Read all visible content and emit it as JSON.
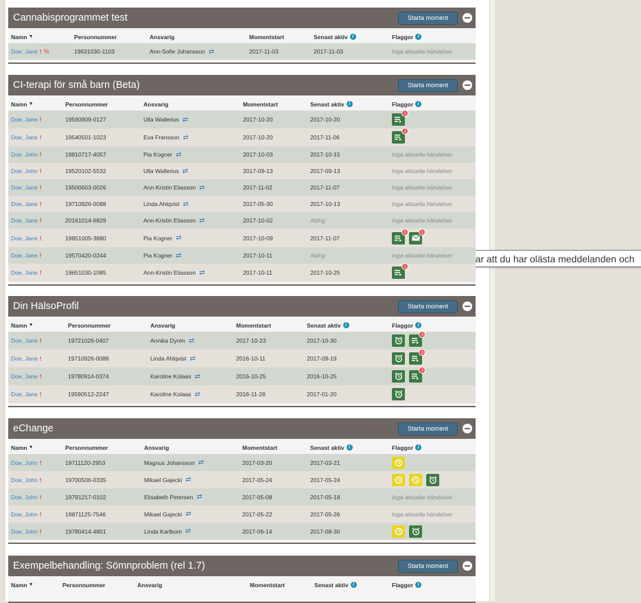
{
  "columns": {
    "name": "Namn",
    "personnummer": "Personnummer",
    "ansvarig": "Ansvarig",
    "momentstart": "Momentstart",
    "senast_aktiv": "Senast aktiv",
    "flaggor": "Flaggor"
  },
  "start_label": "Starta moment",
  "no_events": "Inga aktuella händelser",
  "tooltip": "Flaggan visar att du har olästa meddelanden och",
  "colors": {
    "panel_header": "#6e6663",
    "start_button": "#446c86",
    "row_odd": "#d2d8cf",
    "row_even": "#e6e0db",
    "link": "#3a7fc0",
    "flag_green": "#3d7a44",
    "flag_yellow": "#e8d42a",
    "badge_red": "#e05050"
  },
  "panels": [
    {
      "title": "Cannabisprogrammet test",
      "rows": [
        {
          "name": "Doe, Jane",
          "warn": "!",
          "link_icon": true,
          "pnr": "19631030-1103",
          "ansvarig": "Ann-Sofie Johansson",
          "start": "2017-11-03",
          "last": "2017-11-03",
          "last_muted": false,
          "flags_text": "Inga aktuella händelser",
          "flags": []
        }
      ]
    },
    {
      "title": "CI-terapi för små barn (Beta)",
      "rows": [
        {
          "name": "Doe, Jane",
          "warn": "!",
          "pnr": "19590909-0127",
          "ansvarig": "Ulla Wallerius",
          "start": "2017-10-20",
          "last": "2017-10-20",
          "last_muted": false,
          "flags": [
            {
              "type": "list",
              "color": "green",
              "badge": "1"
            }
          ]
        },
        {
          "name": "Doe, Jane",
          "warn": "!",
          "pnr": "19540501-1023",
          "ansvarig": "Eva Fransson",
          "start": "2017-10-20",
          "last": "2017-11-06",
          "last_muted": false,
          "flags": [
            {
              "type": "list",
              "color": "green",
              "badge": "2"
            }
          ]
        },
        {
          "name": "Doe, John",
          "warn": "!",
          "pnr": "19810717-4057",
          "ansvarig": "Pia Kogner",
          "start": "2017-10-03",
          "last": "2017-10-15",
          "last_muted": false,
          "flags_text": "Inga aktuella händelser",
          "flags": []
        },
        {
          "name": "Doe, John",
          "warn": "!",
          "pnr": "19520102-5532",
          "ansvarig": "Ulla Wallerius",
          "start": "2017-09-13",
          "last": "2017-09-13",
          "last_muted": false,
          "flags_text": "Inga aktuella händelser",
          "flags": []
        },
        {
          "name": "Doe, Jane",
          "warn": "!",
          "pnr": "19500603-0026",
          "ansvarig": "Ann-Kristin Eliasson",
          "start": "2017-11-02",
          "last": "2017-11-07",
          "last_muted": false,
          "flags_text": "Inga aktuella händelser",
          "flags": []
        },
        {
          "name": "Doe, Jane",
          "warn": "!",
          "pnr": "19710926-0088",
          "ansvarig": "Linda Ahlqvist",
          "start": "2017-05-30",
          "last": "2017-10-13",
          "last_muted": false,
          "flags_text": "Inga aktuella händelser",
          "flags": []
        },
        {
          "name": "Doe, Jane",
          "warn": "!",
          "pnr": "20161014-6829",
          "ansvarig": "Ann-Kristin Eliasson",
          "start": "2017-10-02",
          "last": "Aldrig",
          "last_muted": true,
          "flags_text": "Inga aktuella händelser",
          "flags": []
        },
        {
          "name": "Doe, Jane",
          "warn": "!",
          "pnr": "19851005-3880",
          "ansvarig": "Pia Kogner",
          "start": "2017-10-09",
          "last": "2017-11-07",
          "last_muted": false,
          "flags": [
            {
              "type": "list",
              "color": "green",
              "badge": "3"
            },
            {
              "type": "mail",
              "color": "green",
              "badge": "1"
            }
          ]
        },
        {
          "name": "Doe, Jane",
          "warn": "!",
          "pnr": "19570420-0244",
          "ansvarig": "Pia Kogner",
          "start": "2017-10-11",
          "last": "Aldrig",
          "last_muted": true,
          "flags_text": "Inga aktuella händelser",
          "flags": []
        },
        {
          "name": "Doe, Jane",
          "warn": "!",
          "pnr": "19651030-1085",
          "ansvarig": "Ann-Kristin Eliasson",
          "start": "2017-10-11",
          "last": "2017-10-25",
          "last_muted": false,
          "flags": [
            {
              "type": "list",
              "color": "green",
              "badge": "1"
            }
          ]
        }
      ]
    },
    {
      "title": "Din HälsoProfil",
      "rows": [
        {
          "name": "Doe, Jane",
          "warn": "!",
          "pnr": "19721026-0407",
          "ansvarig": "Annika Dyrén",
          "start": "2017-10-23",
          "last": "2017-10-30",
          "last_muted": false,
          "flags": [
            {
              "type": "alarm",
              "color": "green"
            },
            {
              "type": "list",
              "color": "green",
              "badge": "3"
            }
          ]
        },
        {
          "name": "Doe, Jane",
          "warn": "!",
          "pnr": "19710926-0088",
          "ansvarig": "Linda Ahlqvist",
          "start": "2016-10-11",
          "last": "2017-09-19",
          "last_muted": false,
          "flags": [
            {
              "type": "alarm",
              "color": "green"
            },
            {
              "type": "list",
              "color": "green",
              "badge": "3"
            }
          ]
        },
        {
          "name": "Doe, Jane",
          "warn": "!",
          "pnr": "19780914-0374",
          "ansvarig": "Karoline Kolaas",
          "start": "2016-10-25",
          "last": "2016-10-25",
          "last_muted": false,
          "flags": [
            {
              "type": "alarm",
              "color": "green"
            },
            {
              "type": "list",
              "color": "green",
              "badge": "3"
            }
          ]
        },
        {
          "name": "Doe, Jane",
          "warn": "!",
          "pnr": "19590512-2247",
          "ansvarig": "Karoline Kolaas",
          "start": "2016-11-26",
          "last": "2017-01-20",
          "last_muted": false,
          "flags": [
            {
              "type": "alarm",
              "color": "green"
            }
          ]
        }
      ]
    },
    {
      "title": "eChange",
      "rows": [
        {
          "name": "Doe, John",
          "warn": "!",
          "pnr": "19711120-2953",
          "ansvarig": "Magnus Johansson",
          "start": "2017-03-20",
          "last": "2017-03-21",
          "last_muted": false,
          "flags": [
            {
              "type": "clock",
              "color": "yellow"
            }
          ]
        },
        {
          "name": "Doe, John",
          "warn": "!",
          "pnr": "19700506-0335",
          "ansvarig": "Mikael Gajecki",
          "start": "2017-05-24",
          "last": "2017-05-24",
          "last_muted": false,
          "flags": [
            {
              "type": "clock",
              "color": "yellow"
            },
            {
              "type": "clock",
              "color": "yellow"
            },
            {
              "type": "alarm",
              "color": "green"
            }
          ]
        },
        {
          "name": "Doe, John",
          "warn": "!",
          "pnr": "19791217-0102",
          "ansvarig": "Elisabeth Petersen",
          "start": "2017-05-08",
          "last": "2017-05-18",
          "last_muted": false,
          "flags_text": "Inga aktuella händelser",
          "flags": []
        },
        {
          "name": "Doe, John",
          "warn": "!",
          "pnr": "19871125-7546",
          "ansvarig": "Mikael Gajecki",
          "start": "2017-05-22",
          "last": "2017-05-26",
          "last_muted": false,
          "flags_text": "Inga aktuella händelser",
          "flags": []
        },
        {
          "name": "Doe, John",
          "warn": "!",
          "pnr": "19780414-4801",
          "ansvarig": "Linda Karlbom",
          "start": "2017-06-14",
          "last": "2017-08-30",
          "last_muted": false,
          "flags": [
            {
              "type": "clock",
              "color": "yellow"
            },
            {
              "type": "alarm",
              "color": "green"
            }
          ]
        }
      ]
    },
    {
      "title": "Exempelbehandling: Sömnproblem (rel 1.7)",
      "rows": []
    }
  ]
}
